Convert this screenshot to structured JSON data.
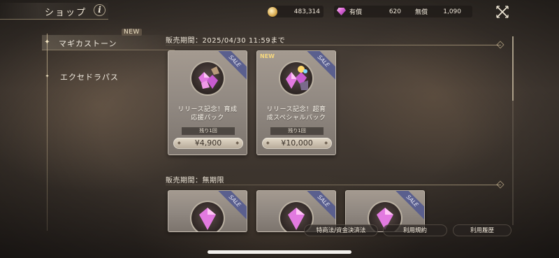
{
  "header": {
    "title": "ショップ",
    "currencies": {
      "coin_amount": "483,314",
      "paid_label": "有償",
      "paid_amount": "620",
      "free_label": "無償",
      "free_amount": "1,090"
    }
  },
  "sidebar": {
    "items": [
      {
        "label": "マギカストーン",
        "active": true,
        "badge": "NEW"
      },
      {
        "label": "エクセドラパス",
        "active": false
      }
    ]
  },
  "sections": [
    {
      "label": "販売期間：2025/04/30 11:59まで",
      "cards": [
        {
          "name_line1": "リリース記念！育成",
          "name_line2": "応援パック",
          "remaining": "残り1回",
          "price": "¥4,900",
          "sale": "SALE",
          "new": ""
        },
        {
          "name_line1": "リリース記念！超育",
          "name_line2": "成スペシャルパック",
          "remaining": "残り1回",
          "price": "¥10,000",
          "sale": "SALE",
          "new": "NEW"
        }
      ]
    },
    {
      "label": "販売期間：無期限",
      "cards": [
        {
          "sale": "SALE"
        },
        {
          "sale": "SALE"
        },
        {
          "sale": "SALE"
        }
      ]
    }
  ],
  "footer": {
    "links": [
      "特商法/資金決済法",
      "利用規約",
      "利用履歴"
    ]
  },
  "colors": {
    "accent_gold": "#d7a94e",
    "gem_pink": "#d65fd1",
    "sale_ribbon": "#5a5f8e"
  },
  "icons": [
    "info-icon",
    "coin-icon",
    "gem-icon",
    "close-icon",
    "star-icon",
    "diamond-icon"
  ]
}
